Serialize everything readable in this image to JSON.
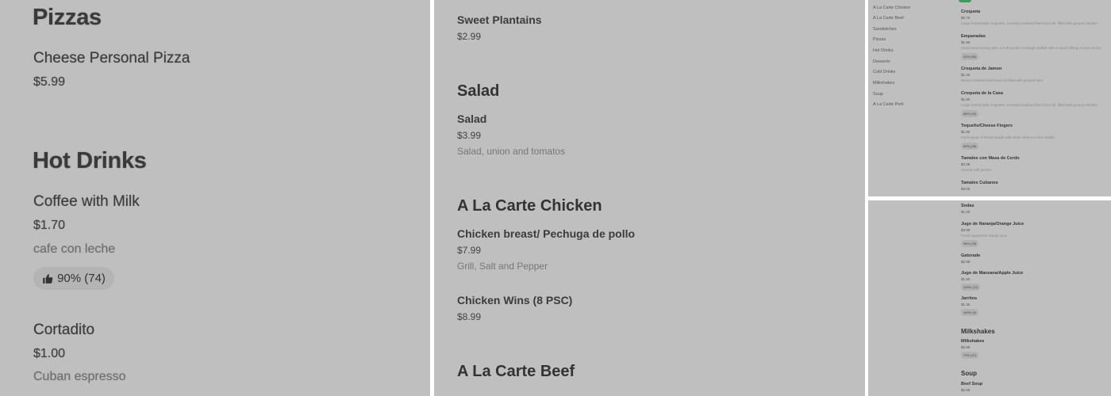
{
  "panel1": {
    "sections": [
      {
        "title": "Pizzas",
        "items": [
          {
            "name": "Cheese Personal Pizza",
            "price": "$5.99"
          }
        ]
      },
      {
        "title": "Hot Drinks",
        "items": [
          {
            "name": "Coffee with Milk",
            "price": "$1.70",
            "desc": "cafe con leche",
            "rating": "90% (74)"
          },
          {
            "name": "Cortadito",
            "price": "$1.00",
            "desc": "Cuban espresso"
          }
        ]
      }
    ]
  },
  "panel2": {
    "top_item": {
      "name": "Sweet Plantains",
      "price": "$2.99"
    },
    "sections": [
      {
        "title": "Salad",
        "items": [
          {
            "name": "Salad",
            "price": "$3.99",
            "desc": "Salad, union and tomatos"
          }
        ]
      },
      {
        "title": "A La Carte Chicken",
        "items": [
          {
            "name": "Chicken breast/ Pechuga de pollo",
            "price": "$7.99",
            "desc": "Grill, Salt and Pepper"
          },
          {
            "name": "Chicken Wins (8 PSC)",
            "price": "$8.99"
          }
        ]
      },
      {
        "title": "A La Carte Beef"
      }
    ]
  },
  "panel3": {
    "sidebar": [
      "A La Carte Chicken",
      "A La Carte Beef",
      "Sandwiches",
      "Pizzas",
      "Hot Drinks",
      "Desserts",
      "Cold Drinks",
      "Milkshakes",
      "Soup",
      "A La Carte Pork"
    ],
    "items": [
      {
        "name": "Croqueta",
        "price": "$0.75",
        "desc": "Large homemade croquette, a bread crumbed fried food roll, filled with ground chicken"
      },
      {
        "name": "Empanadas",
        "price": "$1.85",
        "desc": "Hand-sized savory pies, a soft pocket of dough stuffed with a savory filling of your choice",
        "rating": "92% (90)"
      },
      {
        "name": "Croqueta de Jamon",
        "price": "$1.25",
        "desc": "Bread crumbed fried food roll filled with ground ham"
      },
      {
        "name": "Croqueta de la Casa",
        "price": "$1.50",
        "desc": "Large homemade croquette, a bread crumbed fried food roll, filled with ground chicken",
        "rating": "86% (22)"
      },
      {
        "name": "Tequeño/Cheese Fingers",
        "price": "$1.80",
        "desc": "Fried spear of bread dough with white cheese in the middle",
        "rating": "89% (28)"
      },
      {
        "name": "Tamales con Masa de Cerdo",
        "price": "$3.99",
        "desc": "Served with pieces"
      },
      {
        "name": "Tamales Cubanos",
        "price": "$3.00"
      }
    ]
  },
  "panel4": {
    "items": [
      {
        "name": "Sodas",
        "price": "$1.00"
      },
      {
        "name": "Jugo de Naranja/Orange Juice",
        "price": "$3.99",
        "desc": "Fresh squeezed orange juice",
        "rating": "96% (23)"
      },
      {
        "name": "Gatorade",
        "price": "$2.99"
      },
      {
        "name": "Jugo de Manzana/Apple Juice",
        "price": "$1.50",
        "rating": "100% (12)"
      },
      {
        "name": "Jarritos",
        "price": "$1.35",
        "rating": "100% (9)"
      }
    ],
    "sections": [
      {
        "title": "Milkshakes",
        "items": [
          {
            "name": "Milkshakes",
            "price": "$3.99",
            "rating": "79% (37)"
          }
        ]
      },
      {
        "title": "Soup",
        "items": [
          {
            "name": "Beef Soup",
            "price": "$2.99"
          }
        ]
      }
    ]
  },
  "icons": {
    "rating": "thumbs-up-icon"
  },
  "colors": {
    "panel_bg": "#bfbfbf",
    "divider": "#ffffff",
    "accent": "#2fa35a"
  }
}
